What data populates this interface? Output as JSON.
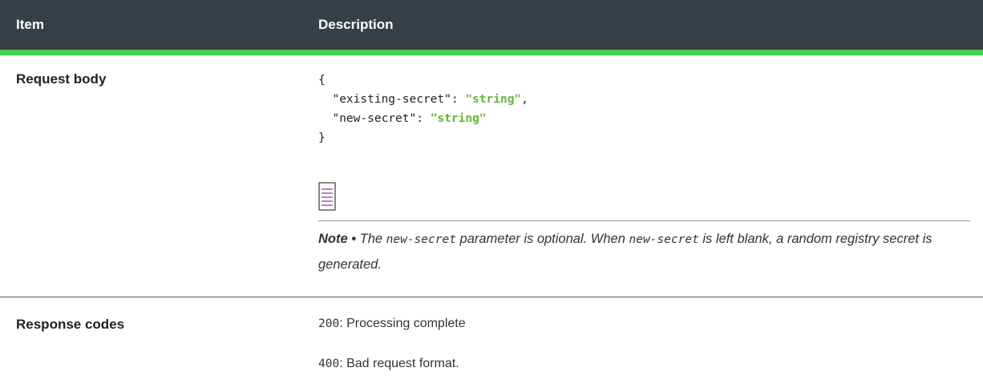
{
  "header": {
    "item": "Item",
    "description": "Description"
  },
  "request_row": {
    "label": "Request body",
    "code": {
      "open_brace": "{",
      "line1_key": "  \"existing-secret\": ",
      "line1_value": "\"string\"",
      "line1_tail": ",",
      "line2_key": "  \"new-secret\": ",
      "line2_value": "\"string\"",
      "close_brace": "}"
    },
    "note": {
      "label": "Note •",
      "text_1": " The ",
      "code_1": "new-secret",
      "text_2": " parameter is optional. When ",
      "code_2": "new-secret",
      "text_3": " is left blank, a random registry secret is generated."
    }
  },
  "response_row": {
    "label": "Response codes",
    "codes": [
      {
        "code": "200",
        "text": ": Processing complete"
      },
      {
        "code": "400",
        "text": ": Bad request format."
      }
    ]
  },
  "colors": {
    "header_bg": "#364049",
    "header_accent": "#42d04a",
    "code_string": "#5fb832",
    "note_icon": "#9b3fa0"
  }
}
